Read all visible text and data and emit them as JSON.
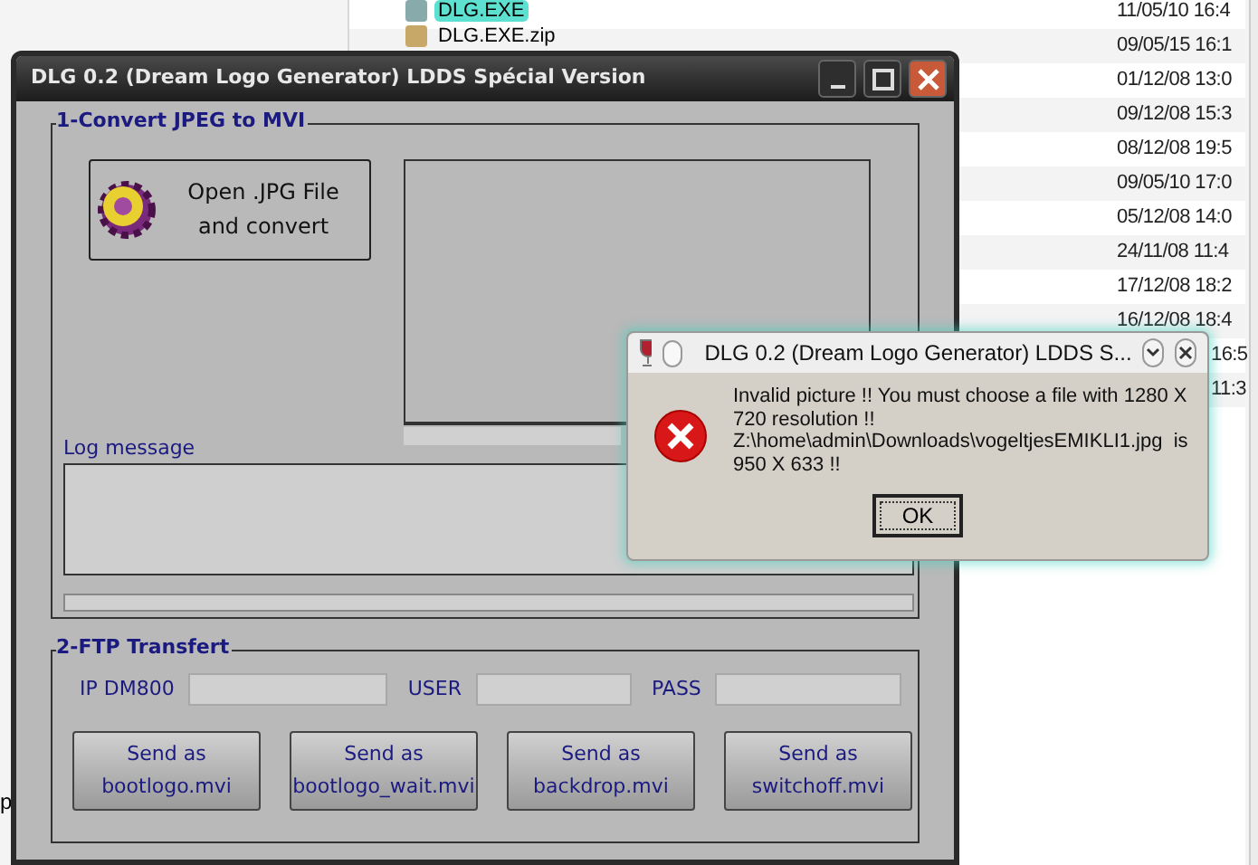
{
  "file_manager": {
    "files": [
      {
        "name": "DLG.EXE",
        "selected": true
      },
      {
        "name": "DLG.EXE.zip",
        "selected": false
      }
    ],
    "dates": [
      "11/05/10 16:4",
      "09/05/15 16:1",
      "01/12/08 13:0",
      "09/12/08 15:3",
      "08/12/08 19:5",
      "09/05/10 17:0",
      "05/12/08 14:0",
      "24/11/08 11:4",
      "17/12/08 18:2",
      "16/12/08 18:4",
      "16:5",
      "11:3"
    ],
    "stray_text": "p"
  },
  "main_window": {
    "title": "DLG 0.2 (Dream Logo Generator) LDDS Spécial Version",
    "convert_group": {
      "title": "1-Convert JPEG to MVI",
      "open_button": [
        "Open .JPG File",
        "and convert"
      ],
      "log_label": "Log message",
      "progress": {
        "level": 0
      }
    },
    "ftp_group": {
      "title": "2-FTP Transfert",
      "fields": [
        {
          "label": "IP DM800"
        },
        {
          "label": "USER"
        },
        {
          "label": "PASS"
        }
      ],
      "send_buttons": [
        [
          "Send as",
          "bootlogo.mvi"
        ],
        [
          "Send as",
          "bootlogo_wait.mvi"
        ],
        [
          "Send as",
          "backdrop.mvi"
        ],
        [
          "Send as",
          "switchoff.mvi"
        ]
      ]
    }
  },
  "dialog": {
    "title": "DLG 0.2 (Dream Logo Generator) LDDS S...",
    "message_lines": [
      "Invalid picture !! You must choose a file with 1280 X",
      "720 resolution !!",
      "Z:\\home\\admin\\Downloads\\vogeltjesEMIKLI1.jpg  is",
      "950 X 633 !!"
    ],
    "ok": "OK"
  }
}
